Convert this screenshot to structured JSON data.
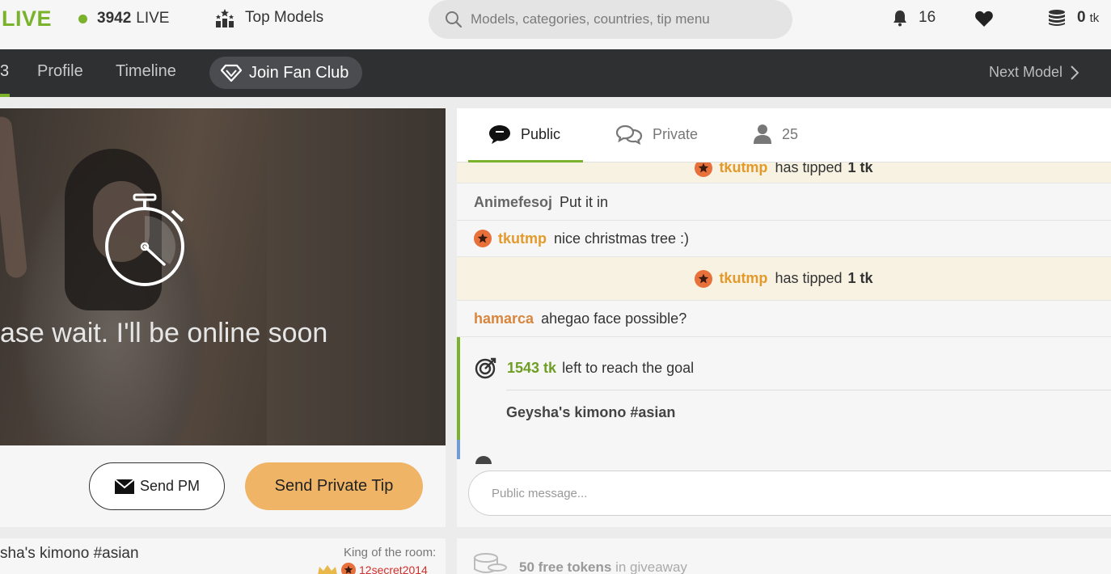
{
  "header": {
    "logo": "LIVE",
    "live_count": "3942",
    "live_label": "LIVE",
    "top_models": "Top Models",
    "search_placeholder": "Models, categories, countries, tip menu",
    "notifications": "16",
    "tokens": "0",
    "tokens_unit": "tk"
  },
  "nav": {
    "number": "3",
    "profile": "Profile",
    "timeline": "Timeline",
    "fan_club": "Join Fan Club",
    "next_model": "Next Model"
  },
  "video": {
    "status_text": "ase wait. I'll be online soon"
  },
  "actions": {
    "send_pm": "Send PM",
    "send_tip": "Send Private Tip"
  },
  "room": {
    "goal_title": "sha's kimono #asian",
    "king_label": "King of the room:",
    "king_user": "12secret2014"
  },
  "chat": {
    "tabs": {
      "public": "Public",
      "private": "Private",
      "users": "25"
    },
    "messages": [
      {
        "type": "tip",
        "user": "tkutmp",
        "text": "has tipped",
        "amount": "1 tk"
      },
      {
        "type": "msg",
        "user": "Animefesoj",
        "text": "Put it in"
      },
      {
        "type": "msg",
        "user": "tkutmp",
        "text": "nice christmas tree :)"
      },
      {
        "type": "tip",
        "user": "tkutmp",
        "text": "has tipped",
        "amount": "1 tk"
      },
      {
        "type": "msg",
        "user": "hamarca",
        "text": "ahegao face possible?"
      }
    ],
    "goal": {
      "amount": "1543 tk",
      "text": "left to reach the goal",
      "title": "Geysha's kimono #asian"
    },
    "input_placeholder": "Public message..."
  },
  "giveaway": {
    "amount": "50 free tokens",
    "text": "in giveaway"
  },
  "colors": {
    "accent": "#7ab22c",
    "tip_button": "#efb466",
    "navbar": "#2f3032",
    "gold_user": "#e49a2a"
  }
}
